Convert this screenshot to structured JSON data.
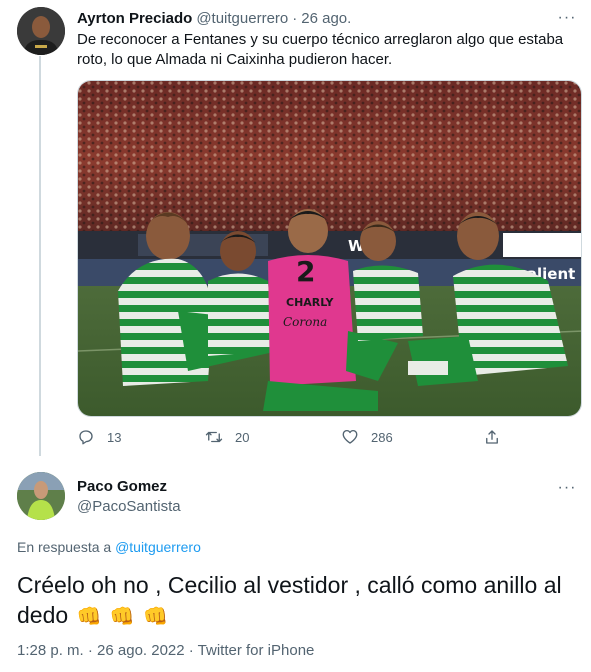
{
  "tweet1": {
    "name": "Ayrton Preciado",
    "handle": "@tuitguerrero",
    "separator": "·",
    "time": "26 ago.",
    "more": "···",
    "text": "De reconocer a Fentanes y su cuerpo técnico arreglaron algo que estaba roto, lo que Almada ni Caixinha pudieron hacer.",
    "media": {
      "jersey_number": "2",
      "jersey_name": "CHARLY",
      "jersey_sponsor": "Corona",
      "banner_text": "WA",
      "banner_text2": "calient"
    },
    "actions": {
      "replies": "13",
      "retweets": "20",
      "likes": "286"
    }
  },
  "tweet2": {
    "name": "Paco Gomez",
    "handle": "@PacoSantista",
    "more": "···",
    "reply_prefix": "En respuesta a",
    "reply_handle": "@tuitguerrero",
    "text": "Créelo oh no , Cecilio al vestidor , calló como anillo al dedo",
    "emojis": [
      "👊",
      "👊",
      "👊"
    ],
    "timestamp": "1:28 p. m. · 26 ago. 2022 · Twitter for iPhone"
  },
  "colors": {
    "text": "#0f1419",
    "secondary": "#536471",
    "link": "#1d9bf0",
    "border": "#cfd9de"
  }
}
